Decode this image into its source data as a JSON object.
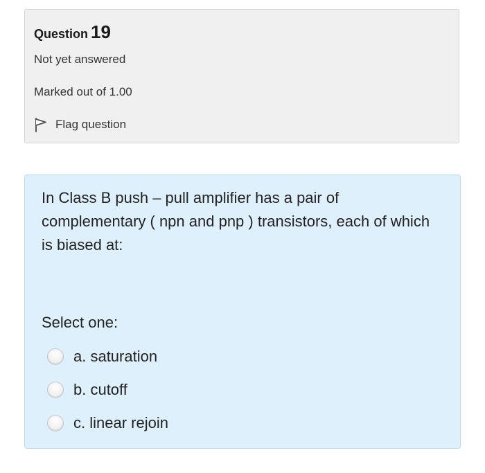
{
  "info": {
    "question_label": "Question",
    "question_number": "19",
    "state": "Not yet answered",
    "grade": "Marked out of 1.00",
    "flag_label": "Flag question",
    "flag_icon": "flag-icon"
  },
  "question": {
    "text": "In Class B push – pull amplifier has a pair of complementary ( npn and pnp ) transistors, each of which is biased at:",
    "prompt": "Select one:",
    "answers": [
      {
        "label": "a. saturation",
        "selected": false
      },
      {
        "label": "b. cutoff",
        "selected": false
      },
      {
        "label": "c. linear rejoin",
        "selected": false
      }
    ]
  },
  "colors": {
    "info_background": "#f0f0f0",
    "question_background": "#def0fb",
    "question_border": "#b7dcef"
  }
}
